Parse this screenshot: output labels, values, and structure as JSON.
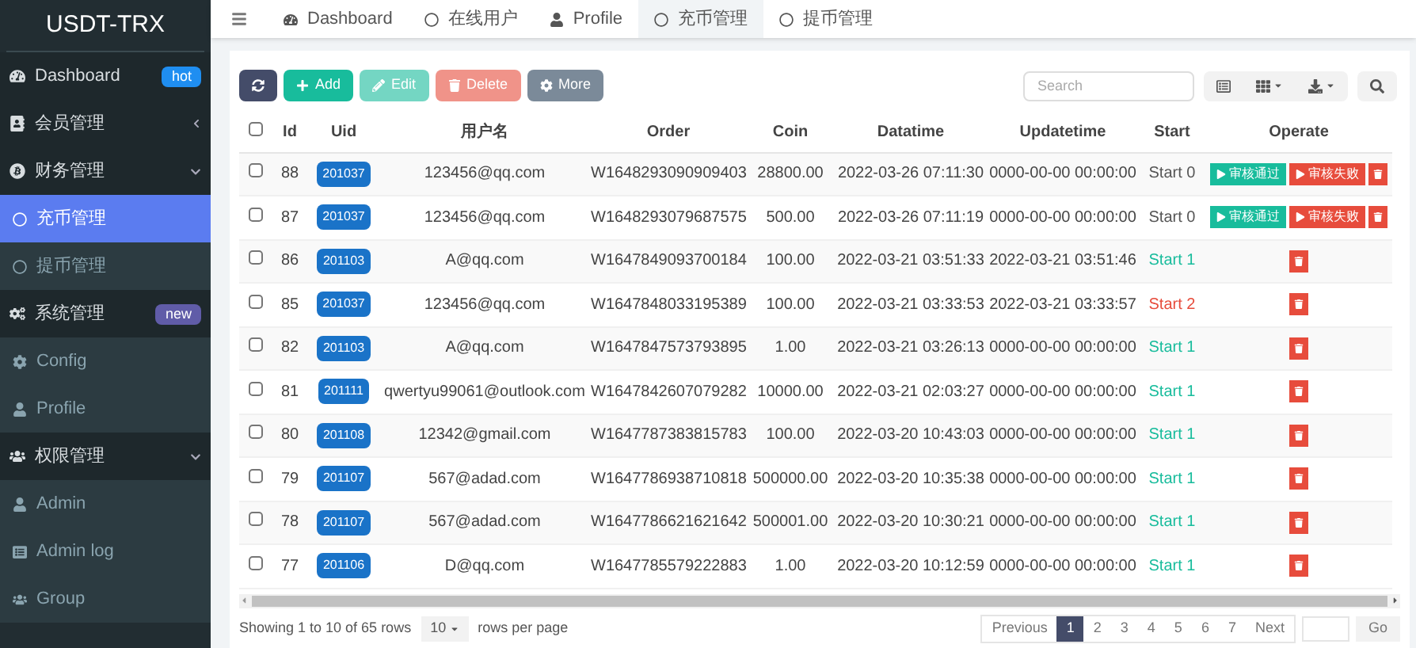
{
  "brand": "USDT-TRX",
  "sidebar": {
    "items": [
      {
        "label": "Dashboard",
        "badge": "hot",
        "color": "#1f8ef1",
        "selected": false
      },
      {
        "label": "会员管理",
        "expanded": false,
        "selected": false
      },
      {
        "label": "财务管理",
        "expanded": true,
        "selected": false,
        "children": [
          {
            "label": "充币管理",
            "selected": true
          },
          {
            "label": "提币管理",
            "selected": false
          }
        ]
      },
      {
        "label": "系统管理",
        "badge": "new",
        "color": "#605ca8",
        "selected": false,
        "children": [
          {
            "label": "Config",
            "selected": false
          },
          {
            "label": "Profile",
            "selected": false
          }
        ]
      },
      {
        "label": "权限管理",
        "expanded": true,
        "selected": false,
        "children": [
          {
            "label": "Admin",
            "selected": false
          },
          {
            "label": "Admin log",
            "selected": false
          },
          {
            "label": "Group",
            "selected": false
          }
        ]
      }
    ]
  },
  "tabs": [
    {
      "label": "Dashboard",
      "selected": false
    },
    {
      "label": "在线用户",
      "selected": false
    },
    {
      "label": "Profile",
      "selected": false
    },
    {
      "label": "充币管理",
      "selected": true
    },
    {
      "label": "提币管理",
      "selected": false
    }
  ],
  "toolbar": {
    "buttons": [
      {
        "kind": "refresh",
        "disabled": false
      },
      {
        "kind": "add",
        "label": "Add",
        "disabled": false
      },
      {
        "kind": "edit",
        "label": "Edit",
        "disabled": true
      },
      {
        "kind": "delete",
        "label": "Delete",
        "disabled": true
      },
      {
        "kind": "more",
        "label": "More",
        "disabled": false
      }
    ],
    "search": {
      "placeholder": "Search"
    }
  },
  "table": {
    "select_all": {
      "checked": false
    },
    "columns": [
      "Id",
      "Uid",
      "用户名",
      "Order",
      "Coin",
      "Datatime",
      "Updatetime",
      "Start",
      "Operate"
    ],
    "rows": [
      {
        "checked": false,
        "id": "88",
        "uid": "201037",
        "user": "123456@qq.com",
        "order": "W1648293090909403",
        "coin": "28800.00",
        "datatime": "2022-03-26 07:11:30",
        "updatetime": "0000-00-00 00:00:00",
        "start": "Start 0",
        "color": "#555555",
        "actions": [
          "审核通过",
          "审核失败"
        ]
      },
      {
        "checked": false,
        "id": "87",
        "uid": "201037",
        "user": "123456@qq.com",
        "order": "W1648293079687575",
        "coin": "500.00",
        "datatime": "2022-03-26 07:11:19",
        "updatetime": "0000-00-00 00:00:00",
        "start": "Start 0",
        "color": "#555555",
        "actions": [
          "审核通过",
          "审核失败"
        ]
      },
      {
        "checked": false,
        "id": "86",
        "uid": "201103",
        "user": "A@qq.com",
        "order": "W1647849093700184",
        "coin": "100.00",
        "datatime": "2022-03-21 03:51:33",
        "updatetime": "2022-03-21 03:51:46",
        "start": "Start 1",
        "color": "#18bc9c"
      },
      {
        "checked": false,
        "id": "85",
        "uid": "201037",
        "user": "123456@qq.com",
        "order": "W1647848033195389",
        "coin": "100.00",
        "datatime": "2022-03-21 03:33:53",
        "updatetime": "2022-03-21 03:33:57",
        "start": "Start 2",
        "color": "#e74c3c"
      },
      {
        "checked": false,
        "id": "82",
        "uid": "201103",
        "user": "A@qq.com",
        "order": "W1647847573793895",
        "coin": "1.00",
        "datatime": "2022-03-21 03:26:13",
        "updatetime": "0000-00-00 00:00:00",
        "start": "Start 1",
        "color": "#18bc9c"
      },
      {
        "checked": false,
        "id": "81",
        "uid": "201111",
        "user": "qwertyu99061@outlook.com",
        "order": "W1647842607079282",
        "coin": "10000.00",
        "datatime": "2022-03-21 02:03:27",
        "updatetime": "0000-00-00 00:00:00",
        "start": "Start 1",
        "color": "#18bc9c"
      },
      {
        "checked": false,
        "id": "80",
        "uid": "201108",
        "user": "12342@gmail.com",
        "order": "W1647787383815783",
        "coin": "100.00",
        "datatime": "2022-03-20 10:43:03",
        "updatetime": "0000-00-00 00:00:00",
        "start": "Start 1",
        "color": "#18bc9c"
      },
      {
        "checked": false,
        "id": "79",
        "uid": "201107",
        "user": "567@adad.com",
        "order": "W1647786938710818",
        "coin": "500000.00",
        "datatime": "2022-03-20 10:35:38",
        "updatetime": "0000-00-00 00:00:00",
        "start": "Start 1",
        "color": "#18bc9c"
      },
      {
        "checked": false,
        "id": "78",
        "uid": "201107",
        "user": "567@adad.com",
        "order": "W1647786621621642",
        "coin": "500001.00",
        "datatime": "2022-03-20 10:30:21",
        "updatetime": "0000-00-00 00:00:00",
        "start": "Start 1",
        "color": "#18bc9c"
      },
      {
        "checked": false,
        "id": "77",
        "uid": "201106",
        "user": "D@qq.com",
        "order": "W1647785579222883",
        "coin": "1.00",
        "datatime": "2022-03-20 10:12:59",
        "updatetime": "0000-00-00 00:00:00",
        "start": "Start 1",
        "color": "#18bc9c"
      }
    ]
  },
  "footer": {
    "summary": "Showing 1 to 10 of 65 rows",
    "page_size": "10",
    "page_size_caption": "rows per page",
    "pages": [
      {
        "label": "Previous",
        "selected": false
      },
      {
        "label": "1",
        "selected": true
      },
      {
        "label": "2",
        "selected": false
      },
      {
        "label": "3",
        "selected": false
      },
      {
        "label": "4",
        "selected": false
      },
      {
        "label": "5",
        "selected": false
      },
      {
        "label": "6",
        "selected": false
      },
      {
        "label": "7",
        "selected": false
      },
      {
        "label": "Next",
        "selected": false
      }
    ],
    "go": "Go"
  }
}
